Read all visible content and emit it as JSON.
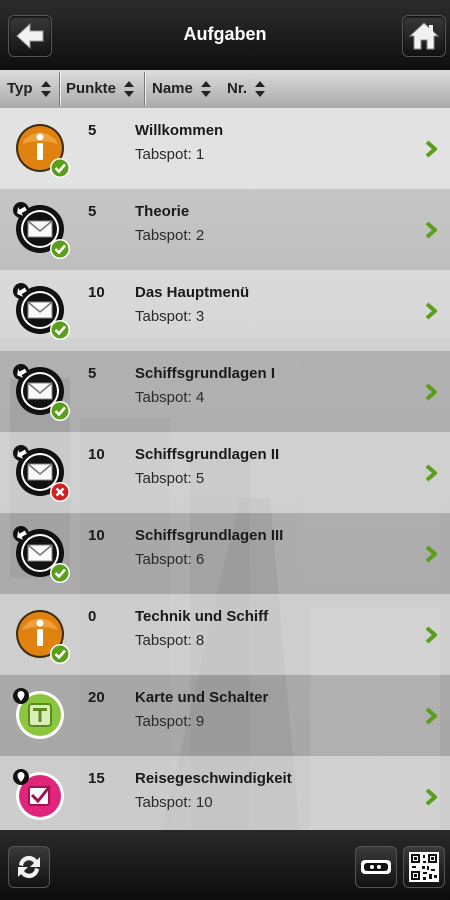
{
  "header": {
    "title": "Aufgaben",
    "back_icon": "back-arrow-icon",
    "home_icon": "home-icon"
  },
  "columns": [
    {
      "label": "Typ"
    },
    {
      "label": "Punkte"
    },
    {
      "label": "Name"
    },
    {
      "label": "Nr."
    }
  ],
  "tasks": [
    {
      "points": "5",
      "name": "Willkommen",
      "tabspot": "Tabspot:  1",
      "type": "info",
      "status": "done"
    },
    {
      "points": "5",
      "name": "Theorie",
      "tabspot": "Tabspot:  2",
      "type": "message",
      "status": "done"
    },
    {
      "points": "10",
      "name": "Das Hauptmenü",
      "tabspot": "Tabspot:  3",
      "type": "message",
      "status": "done"
    },
    {
      "points": "5",
      "name": "Schiffsgrundlagen I",
      "tabspot": "Tabspot:  4",
      "type": "message",
      "status": "done"
    },
    {
      "points": "10",
      "name": "Schiffsgrundlagen II",
      "tabspot": "Tabspot:  5",
      "type": "message",
      "status": "failed"
    },
    {
      "points": "10",
      "name": "Schiffsgrundlagen III",
      "tabspot": "Tabspot:  6",
      "type": "message",
      "status": "done"
    },
    {
      "points": "0",
      "name": "Technik und Schiff",
      "tabspot": "Tabspot:  8",
      "type": "info",
      "status": "done"
    },
    {
      "points": "20",
      "name": "Karte und Schalter",
      "tabspot": "Tabspot:  9",
      "type": "text",
      "status": "none"
    },
    {
      "points": "15",
      "name": "Reisegeschwindigkeit",
      "tabspot": "Tabspot: 10",
      "type": "checkbox",
      "status": "none"
    }
  ],
  "footer": {
    "sync_icon": "sync-icon",
    "toggle_icon": "toggle-view-icon",
    "qr_icon": "qr-code-icon"
  },
  "colors": {
    "accent_green": "#5a9e1c",
    "info_orange": "#e0820f",
    "text_green": "#8cc63e",
    "checkbox_pink": "#e0257a",
    "fail_red": "#d21f1f"
  }
}
